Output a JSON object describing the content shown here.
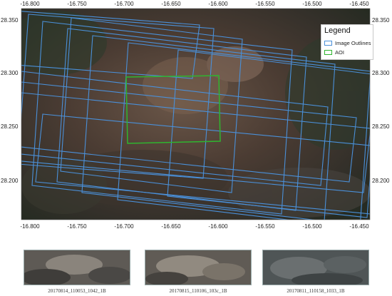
{
  "legend": {
    "title": "Legend",
    "items": [
      {
        "label": "Image Outlines",
        "color": "#4a90d9"
      },
      {
        "label": "AOI",
        "color": "#2fb52f"
      }
    ]
  },
  "map": {
    "x_ticks": [
      "-16.800",
      "-16.750",
      "-16.700",
      "-16.650",
      "-16.600",
      "-16.550",
      "-16.500",
      "-16.450"
    ],
    "y_ticks": [
      "28.350",
      "28.300",
      "28.250",
      "28.200"
    ],
    "outline_color": "#4a90d9",
    "aoi_color": "#2fb52f"
  },
  "thumbnails": [
    {
      "caption": "20170814_110053_1042_1B"
    },
    {
      "caption": "20170815_110106_103c_1B"
    },
    {
      "caption": "20170811_110158_1033_1B"
    }
  ]
}
